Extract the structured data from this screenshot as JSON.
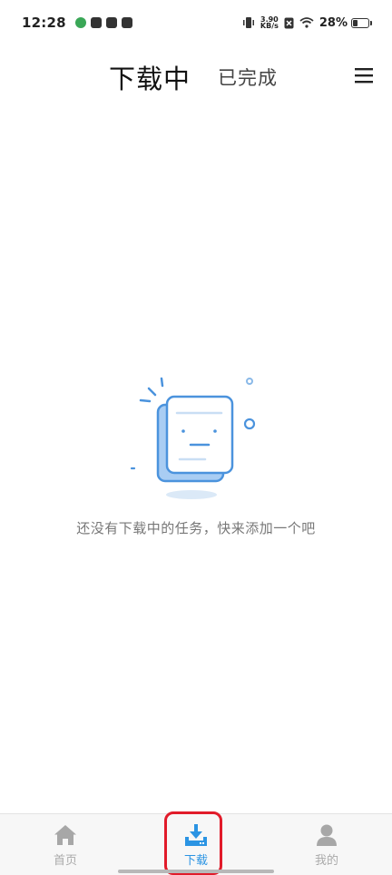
{
  "status_bar": {
    "time": "12:28",
    "net_speed_value": "3.90",
    "net_speed_unit": "KB/s",
    "battery_percent": "28%",
    "battery_level": 0.28
  },
  "header": {
    "active_tab": "下载中",
    "inactive_tab": "已完成",
    "menu_icon": "menu-icon"
  },
  "empty_state": {
    "message": "还没有下载中的任务，快来添加一个吧",
    "illustration": "empty-document-icon"
  },
  "bottom_nav": {
    "items": [
      {
        "label": "首页",
        "icon": "home-icon",
        "active": false
      },
      {
        "label": "下载",
        "icon": "download-icon",
        "active": true
      },
      {
        "label": "我的",
        "icon": "user-icon",
        "active": false
      }
    ]
  },
  "colors": {
    "accent": "#2b94e3",
    "inactive": "#aaaaaa",
    "highlight": "#e11b2a"
  }
}
